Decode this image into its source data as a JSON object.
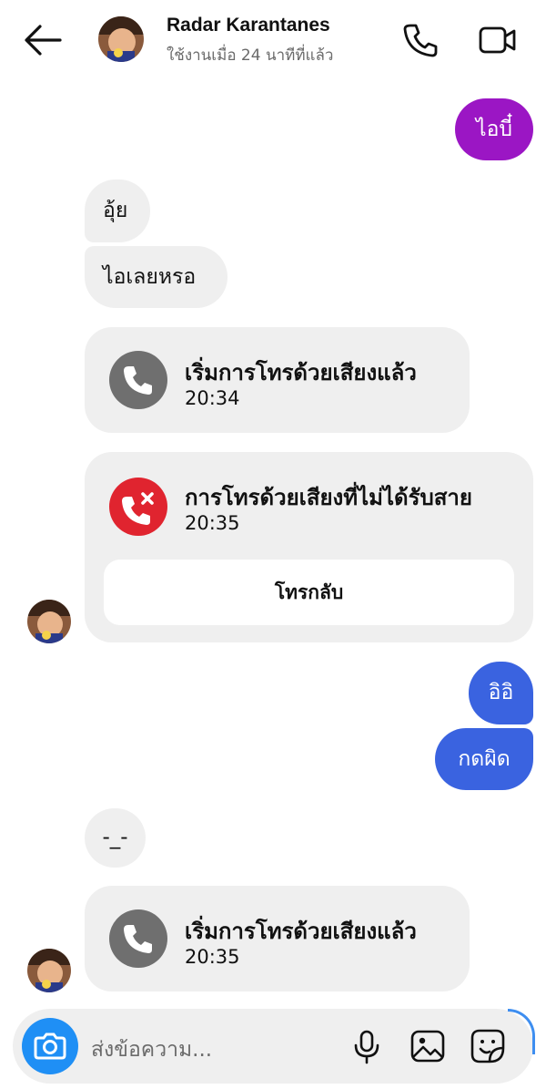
{
  "header": {
    "contact_name": "Radar Karantanes",
    "status": "ใช้งานเมื่อ 24 นาทีที่แล้ว",
    "icons": [
      "back-arrow-icon",
      "phone-icon",
      "video-camera-icon"
    ]
  },
  "messages": [
    {
      "type": "outgoing",
      "text": "ไอบี๋",
      "color": "#9B16C4"
    },
    {
      "type": "incoming",
      "text": "อุ้ย"
    },
    {
      "type": "incoming",
      "text": "ไอเลยหรอ"
    },
    {
      "type": "call",
      "title": "เริ่มการโทรด้วยเสียงแล้ว",
      "time": "20:34",
      "icon": "phone-icon"
    },
    {
      "type": "missed-call",
      "title": "การโทรด้วยเสียงที่ไม่ได้รับสาย",
      "time": "20:35",
      "icon": "missed-call-icon",
      "action": "โทรกลับ"
    },
    {
      "type": "outgoing",
      "text": "อิอิ",
      "color": "#3A63E0"
    },
    {
      "type": "outgoing",
      "text": "กดผิด",
      "color": "#3A63E0"
    },
    {
      "type": "incoming",
      "text": "-_-"
    },
    {
      "type": "call",
      "title": "เริ่มการโทรด้วยเสียงแล้ว",
      "time": "20:35",
      "icon": "phone-icon"
    }
  ],
  "composer": {
    "placeholder": "ส่งข้อความ...",
    "icons": [
      "camera-icon",
      "microphone-icon",
      "gallery-icon",
      "sticker-icon"
    ]
  },
  "colors": {
    "accent_purple": "#9B16C4",
    "accent_blue": "#3A63E0",
    "missed_red": "#E0242F",
    "call_gray": "#6f6f6f",
    "camera_blue": "#1f8ff5"
  }
}
